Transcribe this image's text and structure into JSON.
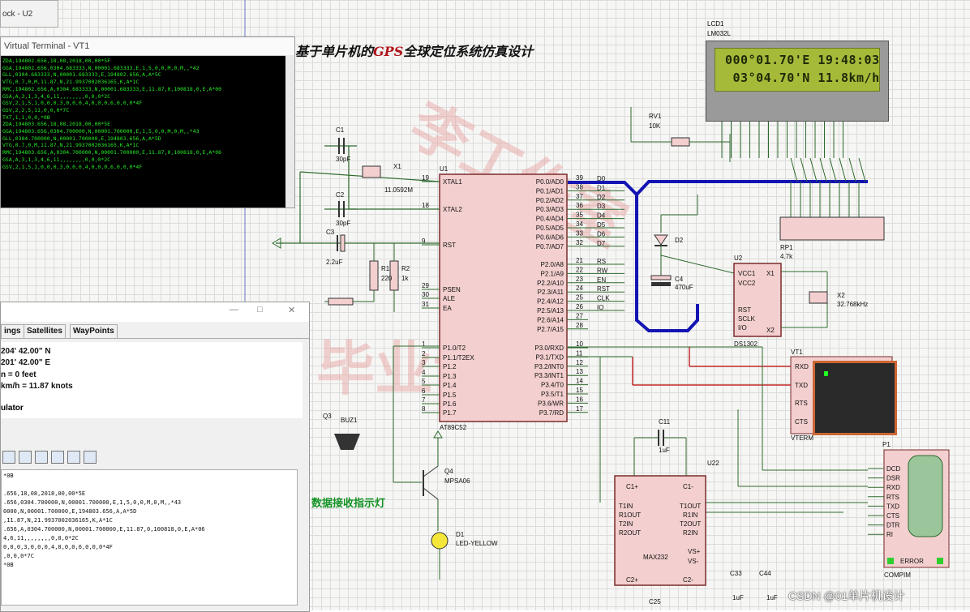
{
  "window_tab": "ock - U2",
  "title": {
    "prefix": "基于单片机的",
    "gps": "GPS",
    "suffix": "全球定位系统仿真设计"
  },
  "watermark": {
    "line1": "李工作室",
    "line2": "毕业设计"
  },
  "lcd": {
    "ref": "LCD1",
    "model": "LM032L",
    "line1": "000°01.70'E 19:48:03",
    "line2": " 03°04.70'N 11.8km/h"
  },
  "virtual_terminal": {
    "title": "Virtual Terminal - VT1",
    "lines": [
      "ZDA,194802.656,18,08,2018,00,00*5F",
      "GGA,194802.656,0304.683333,N,00001.683333,E,1,5,0,0,M,0,M,,*42",
      "GLL,0304.683333,N,00001.683333,E,194802.656,A,A*5C",
      "VTG,0.7,0,M,11.87,N,21.9937002036165,K,A*1C",
      "RMC,194802.656,A,0304.683333,N,00001.683333,E,11.87,0,100818,0,E,A*00",
      "GSA,A,3,1,3,4,6,11,,,,,,,,0,0,0*2C",
      "GSV,2,1,5,1,0,0,0,3,0,0,0,4,0,0,0,6,0,0,0*4F",
      "GSV,2,2,5,11,0,0,0*7C",
      "TXT,1,1,0,0,*0B",
      "ZDA,194803.656,18,08,2018,00,00*5E",
      "GGA,194803.656,0304.700000,N,00001.700000,E,1,5,0,0,M,0,M,,*43",
      "GLL,0304.700000,N,00001.700000,E,194803.656,A,A*5D",
      "VTG,0.7,0,M,11.87,N,21.9937002036165,K,A*1C",
      "RMC,194803.656,A,0304.700000,N,00001.700000,E,11.87,0,100818,0,E,A*06",
      "GSA,A,3,1,3,4,6,11,,,,,,,,0,0,0*2C",
      "GSV,2,1,5,1,0,0,0,3,0,0,0,4,0,0,0,6,0,0,0*4F"
    ]
  },
  "gps_window": {
    "tabs": [
      "ings",
      "Satellites",
      "WayPoints"
    ],
    "lat": "204' 42.00\" N",
    "lon": "201' 42.00\" E",
    "alt": "n = 0 feet",
    "speed": "km/h = 11.87 knots",
    "emulator": "ulator",
    "log_lines": [
      "*0B",
      "",
      ".656,18,08,2018,00,00*5E",
      ".656,0304.700000,N,00001.700000,E,1,5,0,0,M,0,M,,*43",
      "0000,N,00001.700000,E,194803.656,A,A*5D",
      ",11.87,N,21.9937002036165,K,A*1C",
      ".656,A,0304.700000,N,00001.700000,E,11.87,0,100818,0,E,A*06",
      "4,6,11,,,,,,,,0,0,0*2C",
      "0,0,0,3,0,0,0,4,0,0,0,6,0,0,0*4F",
      ",0,0,0*7C",
      "*0B"
    ]
  },
  "mcu": {
    "ref": "U1",
    "model": "AT89C52",
    "left_pins": [
      {
        "num": "19",
        "name": "XTAL1"
      },
      {
        "num": "18",
        "name": "XTAL2"
      },
      {
        "num": "9",
        "name": "RST"
      },
      {
        "num": "29",
        "name": "PSEN"
      },
      {
        "num": "30",
        "name": "ALE"
      },
      {
        "num": "31",
        "name": "EA"
      },
      {
        "num": "1",
        "name": "P1.0/T2"
      },
      {
        "num": "2",
        "name": "P1.1/T2EX"
      },
      {
        "num": "3",
        "name": "P1.2"
      },
      {
        "num": "4",
        "name": "P1.3"
      },
      {
        "num": "5",
        "name": "P1.4"
      },
      {
        "num": "6",
        "name": "P1.5"
      },
      {
        "num": "7",
        "name": "P1.6"
      },
      {
        "num": "8",
        "name": "P1.7"
      }
    ],
    "right_pins": [
      {
        "num": "39",
        "name": "P0.0/AD0",
        "net": "D0"
      },
      {
        "num": "38",
        "name": "P0.1/AD1",
        "net": "D1"
      },
      {
        "num": "37",
        "name": "P0.2/AD2",
        "net": "D2"
      },
      {
        "num": "36",
        "name": "P0.3/AD3",
        "net": "D3"
      },
      {
        "num": "35",
        "name": "P0.4/AD4",
        "net": "D4"
      },
      {
        "num": "34",
        "name": "P0.5/AD5",
        "net": "D5"
      },
      {
        "num": "33",
        "name": "P0.6/AD6",
        "net": "D6"
      },
      {
        "num": "32",
        "name": "P0.7/AD7",
        "net": "D7"
      },
      {
        "num": "21",
        "name": "P2.0/A8",
        "net": "RS"
      },
      {
        "num": "22",
        "name": "P2.1/A9",
        "net": "RW"
      },
      {
        "num": "23",
        "name": "P2.2/A10",
        "net": "EN"
      },
      {
        "num": "24",
        "name": "P2.3/A11",
        "net": "RST"
      },
      {
        "num": "25",
        "name": "P2.4/A12",
        "net": "CLK"
      },
      {
        "num": "26",
        "name": "P2.5/A13",
        "net": "IO"
      },
      {
        "num": "27",
        "name": "P2.6/A14",
        "net": ""
      },
      {
        "num": "28",
        "name": "P2.7/A15",
        "net": ""
      },
      {
        "num": "10",
        "name": "P3.0/RXD",
        "net": ""
      },
      {
        "num": "11",
        "name": "P3.1/TXD",
        "net": ""
      },
      {
        "num": "12",
        "name": "P3.2/INT0",
        "net": ""
      },
      {
        "num": "13",
        "name": "P3.3/INT1",
        "net": ""
      },
      {
        "num": "14",
        "name": "P3.4/T0",
        "net": ""
      },
      {
        "num": "15",
        "name": "P3.5/T1",
        "net": ""
      },
      {
        "num": "16",
        "name": "P3.6/WR",
        "net": ""
      },
      {
        "num": "17",
        "name": "P3.7/RD",
        "net": ""
      }
    ]
  },
  "parts": {
    "c1": {
      "ref": "C1",
      "val": "30pF"
    },
    "c2": {
      "ref": "C2",
      "val": "30pF"
    },
    "x1": {
      "ref": "X1",
      "val": "11.0592M"
    },
    "c3": {
      "ref": "C3",
      "val": "2.2uF"
    },
    "r1": {
      "ref": "R1",
      "val": "220"
    },
    "r2": {
      "ref": "R2",
      "val": "1k"
    },
    "rv1": {
      "ref": "RV1",
      "val": "10K"
    },
    "rp1": {
      "ref": "RP1",
      "val": "4.7k"
    },
    "d2": {
      "ref": "D2"
    },
    "c4": {
      "ref": "C4",
      "val": "470uF"
    },
    "u2": {
      "ref": "U2",
      "model": "DS1302",
      "pins": [
        "VCC1",
        "VCC2",
        "RST",
        "SCLK",
        "I/O",
        "X1",
        "X2"
      ]
    },
    "x2": {
      "ref": "X2",
      "val": "32.768kHz"
    },
    "q3": {
      "ref": "Q3"
    },
    "buz": {
      "ref": "BUZ1"
    },
    "q4": {
      "ref": "Q4",
      "val": "MPSA06"
    },
    "d1": {
      "ref": "D1",
      "val": "LED-YELLOW"
    },
    "c11": {
      "ref": "C11",
      "val": "1uF"
    },
    "u22": {
      "ref": "U22",
      "model": "MAX232",
      "left": [
        "C1+",
        "T1IN",
        "R1OUT",
        "T2IN",
        "R2OUT"
      ],
      "right": [
        "C1-",
        "T1OUT",
        "R1IN",
        "T2OUT",
        "R2IN",
        "VS+",
        "VS-"
      ],
      "bottom": [
        "C2+",
        "C2-"
      ]
    },
    "c33": {
      "ref": "C33",
      "val": "1uF"
    },
    "c44": {
      "ref": "C44",
      "val": "1uF"
    },
    "c25": {
      "ref": "C25"
    },
    "vt1": {
      "ref": "VT1",
      "model": "VTERM",
      "pins": [
        "RXD",
        "TXD",
        "RTS",
        "CTS"
      ]
    },
    "p1": {
      "ref": "P1",
      "model": "COMPIM",
      "pins": [
        "DCD",
        "DSR",
        "RXD",
        "RTS",
        "TXD",
        "CTS",
        "DTR",
        "RI"
      ],
      "error": "ERROR"
    }
  },
  "green_label": "数据接收指示灯",
  "csdn": "CSDN @01单片机设计"
}
